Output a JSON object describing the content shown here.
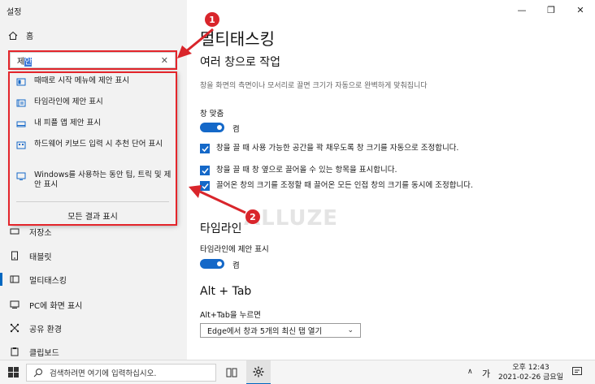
{
  "window": {
    "title": "설정"
  },
  "left": {
    "home_label": "홈",
    "search": {
      "value_prefix": "제",
      "value_selected": "안",
      "clear_glyph": "✕"
    },
    "suggestions": [
      {
        "label": "때때로 시작 메뉴에 제안 표시",
        "icon": "start-menu-icon"
      },
      {
        "label": "타임라인에 제안 표시",
        "icon": "timeline-icon"
      },
      {
        "label": "내 피플 앱 제안 표시",
        "icon": "taskbar-icon"
      },
      {
        "label": "하드웨어 키보드 입력 시 추천 단어 표시",
        "icon": "keyboard-icon"
      },
      {
        "label": "Windows를 사용하는 동안 팁, 트릭 및 제안 표시",
        "icon": "monitor-icon"
      }
    ],
    "show_all": "모든 결과 표시",
    "nav": [
      {
        "label": "저장소",
        "icon": "storage-icon"
      },
      {
        "label": "태블릿",
        "icon": "tablet-icon"
      },
      {
        "label": "멀티태스킹",
        "icon": "multitasking-icon"
      },
      {
        "label": "PC에 화면 표시",
        "icon": "project-icon"
      },
      {
        "label": "공유 환경",
        "icon": "shared-icon"
      },
      {
        "label": "클립보드",
        "icon": "clipboard-icon"
      }
    ]
  },
  "right": {
    "page_title": "멀티태스킹",
    "snap": {
      "heading": "여러 창으로 작업",
      "desc": "창을 화면의 측면이나 모서리로 끌면 크기가 자동으로 완벽하게 맞춰집니다",
      "toggle_label": "창 맞춤",
      "toggle_state": "켬",
      "checkboxes": [
        "창을 끌 때 사용 가능한 공간을 꽉 채우도록 창 크기를 자동으로 조정합니다.",
        "창을 끌 때 창 옆으로 끌어올 수 있는 항목을 표시합니다.",
        "끌어온 창의 크기를 조정할 때 끌어온 모든 인접 창의 크기를 동시에 조정합니다."
      ]
    },
    "timeline": {
      "heading": "타임라인",
      "toggle_label": "타임라인에 제안 표시",
      "toggle_state": "켬"
    },
    "alttab": {
      "heading": "Alt + Tab",
      "label": "Alt+Tab을 누르면",
      "dropdown_value": "Edge에서 창과 5개의 최신 탭 열기"
    },
    "watermark": "ALLUZE"
  },
  "annotations": {
    "badge1": "1",
    "badge2": "2",
    "color": "#d9252b"
  },
  "taskbar": {
    "search_placeholder": "검색하려면 여기에 입력하십시오.",
    "ime": "가",
    "time": "오후 12:43",
    "date": "2021-02-26 금요일"
  }
}
